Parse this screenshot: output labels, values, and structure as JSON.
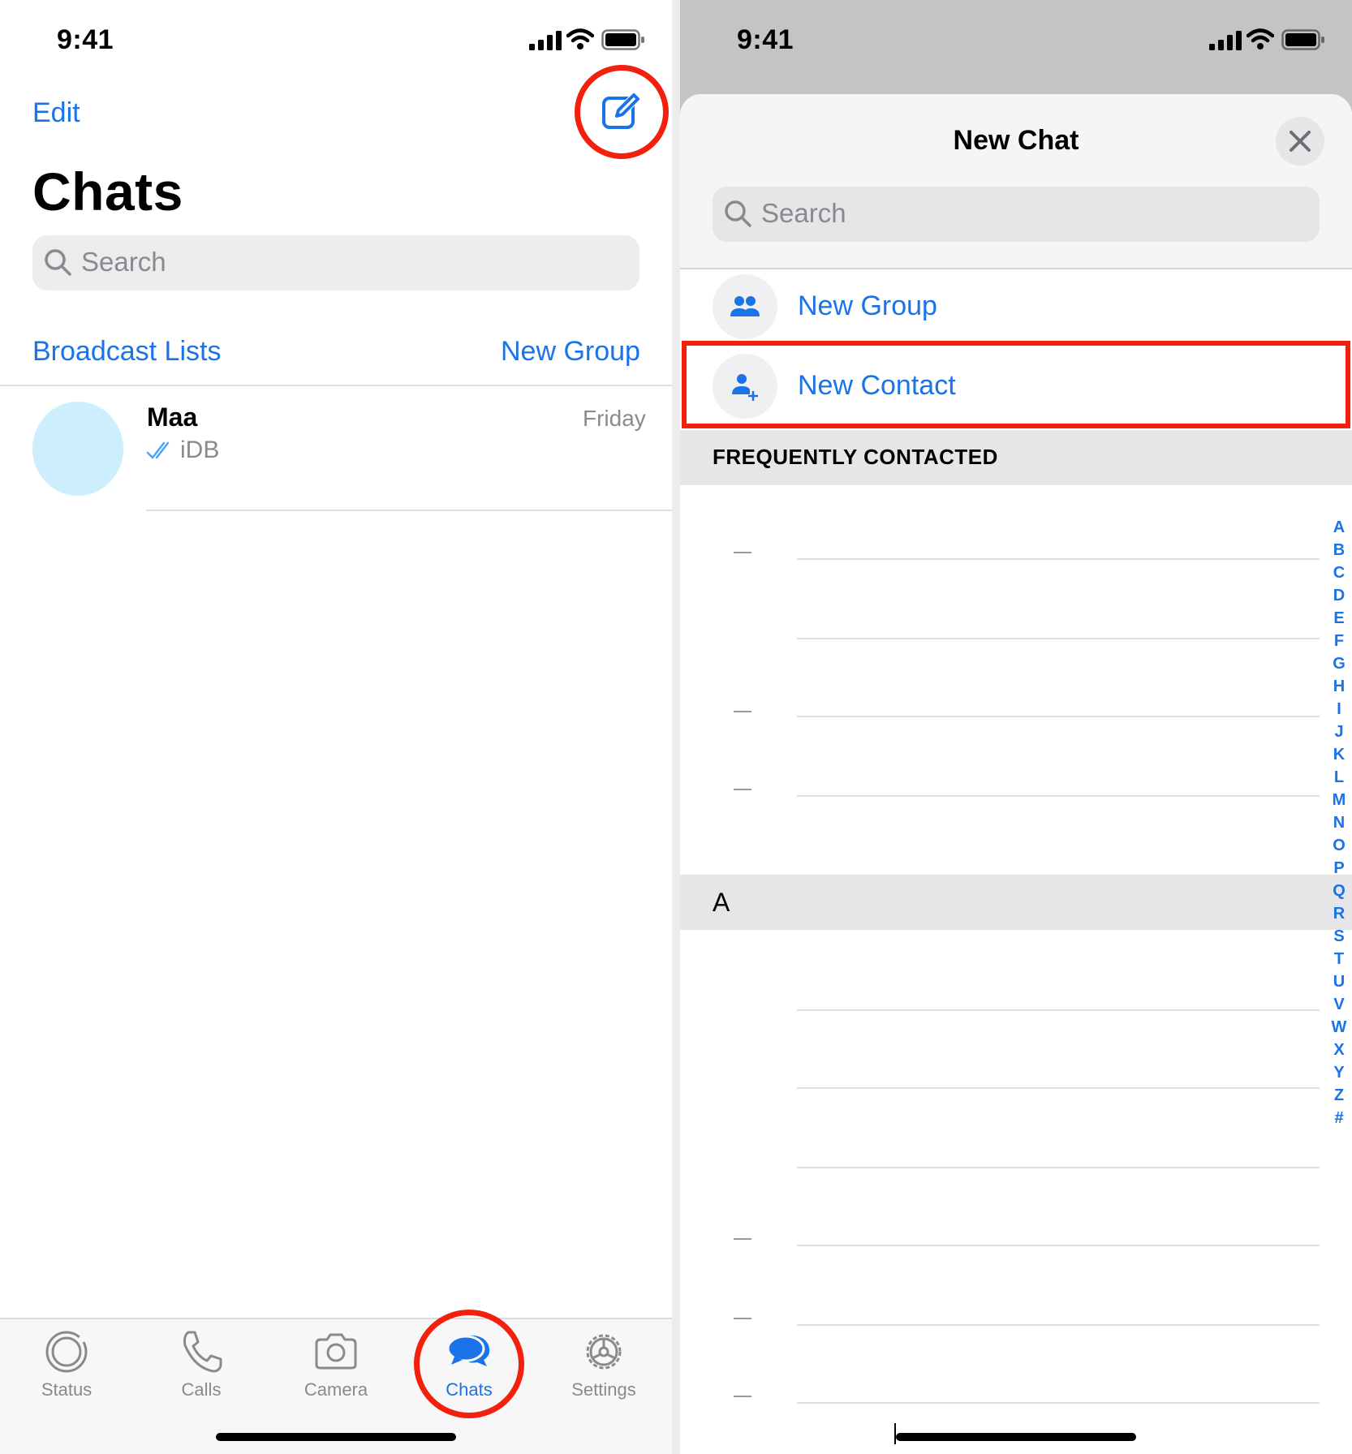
{
  "status_bar": {
    "time": "9:41"
  },
  "chats_screen": {
    "edit_label": "Edit",
    "title": "Chats",
    "search_placeholder": "Search",
    "broadcast_lists_label": "Broadcast Lists",
    "new_group_label": "New Group",
    "chats": [
      {
        "name": "Maa",
        "time": "Friday",
        "preview": "iDB",
        "avatar_color": "#cdeefc"
      }
    ],
    "tabs": [
      {
        "label": "Status",
        "active": false
      },
      {
        "label": "Calls",
        "active": false
      },
      {
        "label": "Camera",
        "active": false
      },
      {
        "label": "Chats",
        "active": true
      },
      {
        "label": "Settings",
        "active": false
      }
    ]
  },
  "new_chat_sheet": {
    "title": "New Chat",
    "search_placeholder": "Search",
    "actions": [
      {
        "label": "New Group",
        "icon": "group-icon"
      },
      {
        "label": "New Contact",
        "icon": "add-contact-icon"
      }
    ],
    "frequently_contacted_header": "FREQUENTLY CONTACTED",
    "section_a_header": "A",
    "index_letters": [
      "A",
      "B",
      "C",
      "D",
      "E",
      "F",
      "G",
      "H",
      "I",
      "J",
      "K",
      "L",
      "M",
      "N",
      "O",
      "P",
      "Q",
      "R",
      "S",
      "T",
      "U",
      "V",
      "W",
      "X",
      "Y",
      "Z",
      "#"
    ]
  },
  "colors": {
    "accent": "#1a73e8",
    "highlight": "#f2200d",
    "tab_inactive": "#8a8a8e"
  }
}
